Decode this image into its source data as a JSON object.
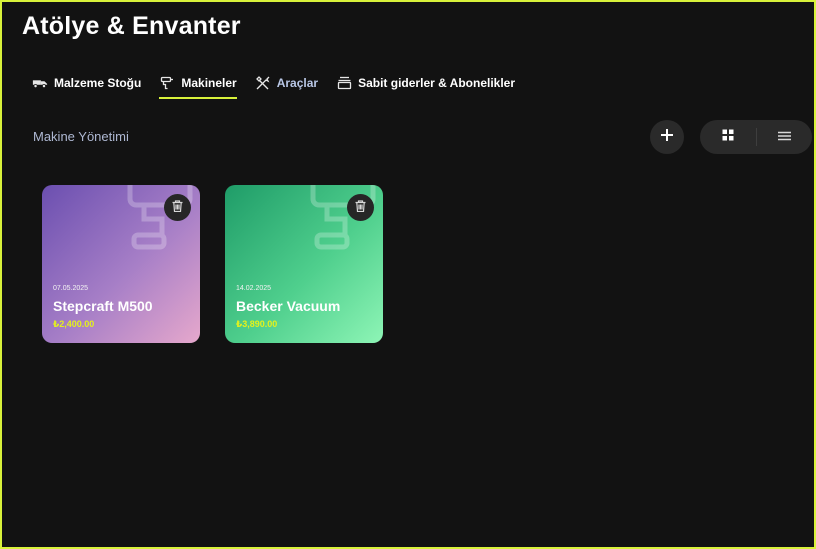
{
  "header": {
    "title": "Atölye & Envanter"
  },
  "tabs": [
    {
      "label": "Malzeme Stoğu",
      "icon": "truck-icon"
    },
    {
      "label": "Makineler",
      "icon": "drill-icon",
      "active": true
    },
    {
      "label": "Araçlar",
      "icon": "tools-icon"
    },
    {
      "label": "Sabit giderler & Abonelikler",
      "icon": "subscription-icon"
    }
  ],
  "section": {
    "title": "Makine Yönetimi"
  },
  "toolbar": {
    "add_icon": "plus-icon",
    "grid_icon": "grid-icon",
    "list_icon": "list-icon"
  },
  "machines": [
    {
      "date": "07.05.2025",
      "name": "Stepcraft M500",
      "price": "₺2,400.00",
      "icon": "drill-icon",
      "colors": [
        "#6b4fb0",
        "#e6a8cc"
      ]
    },
    {
      "date": "14.02.2025",
      "name": "Becker Vacuum",
      "price": "₺3,890.00",
      "icon": "drill-icon",
      "colors": [
        "#1f9c68",
        "#8ef5b6"
      ]
    }
  ],
  "colors": {
    "accent": "#d8f23a",
    "price": "#e4f21c",
    "background": "#121212"
  }
}
